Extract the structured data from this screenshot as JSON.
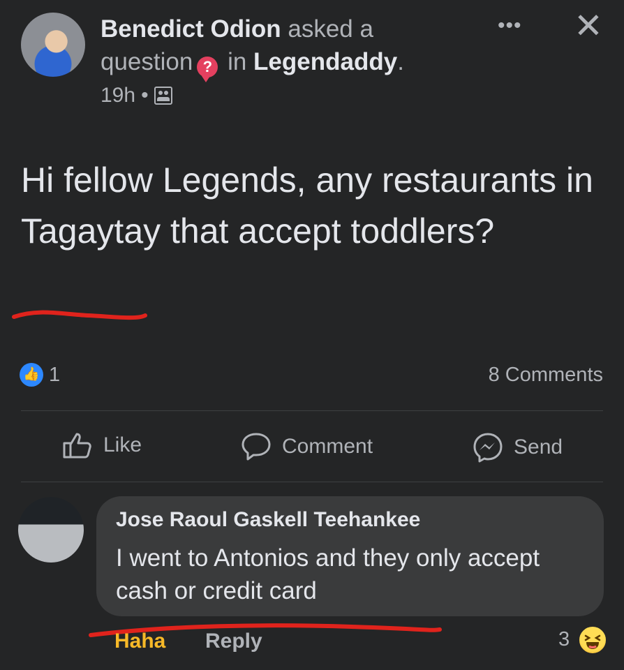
{
  "post": {
    "author": "Benedict Odion",
    "action_text_1": "asked a",
    "action_text_2": "question",
    "qmark": "?",
    "in_text": "in",
    "group": "Legendaddy",
    "period": ".",
    "time": "19h",
    "separator": "•",
    "body": "Hi fellow Legends,  any restaurants in Tagaytay that accept toddlers?",
    "like_count": "1",
    "comments_count": "8 Comments"
  },
  "actions": {
    "like": "Like",
    "comment": "Comment",
    "send": "Send"
  },
  "comment": {
    "author": "Jose Raoul Gaskell Teehankee",
    "text": "I went to Antonios and they only accept cash or credit card",
    "reaction_label": "Haha",
    "reply_label": "Reply",
    "reaction_count": "3"
  },
  "header_icons": {
    "more": "•••",
    "close": "✕"
  },
  "colors": {
    "background": "#242526",
    "bubble": "#3a3b3c",
    "accent_blue": "#2d88ff",
    "haha_yellow": "#f7b928",
    "annotation_red": "#e0231c"
  }
}
